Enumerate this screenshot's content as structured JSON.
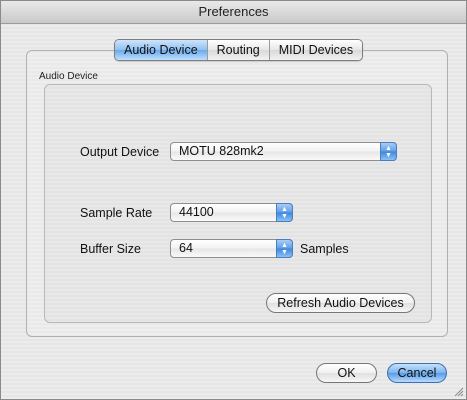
{
  "window": {
    "title": "Preferences"
  },
  "tabs": [
    {
      "label": "Audio Device",
      "active": true
    },
    {
      "label": "Routing",
      "active": false
    },
    {
      "label": "MIDI Devices",
      "active": false
    }
  ],
  "group": {
    "label": "Audio Device"
  },
  "output_device": {
    "label": "Output Device",
    "value": "MOTU 828mk2"
  },
  "sample_rate": {
    "label": "Sample Rate",
    "value": "44100"
  },
  "buffer_size": {
    "label": "Buffer Size",
    "value": "64",
    "unit": "Samples"
  },
  "buttons": {
    "refresh": "Refresh Audio Devices",
    "ok": "OK",
    "cancel": "Cancel"
  },
  "colors": {
    "accent": "#6aa9ec",
    "default_button": "#5a9ae6"
  }
}
